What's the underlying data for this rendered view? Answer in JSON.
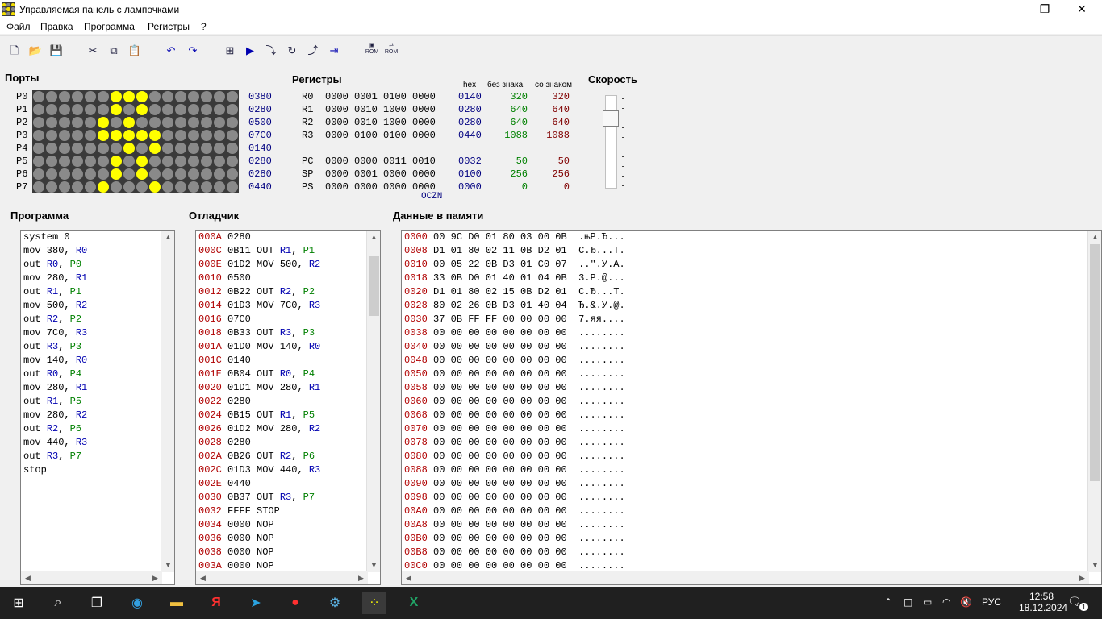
{
  "window": {
    "title": "Управляемая панель с лампочками",
    "minimize": "—",
    "maximize": "❐",
    "close": "✕"
  },
  "menu": [
    "Файл",
    "Правка",
    "Программа",
    "Регистры",
    "?"
  ],
  "toolbar": {
    "rom1": "ROM",
    "rom2": "ROM"
  },
  "ports": {
    "title": "Порты",
    "rows": [
      {
        "label": "P0",
        "hex": "0380"
      },
      {
        "label": "P1",
        "hex": "0280"
      },
      {
        "label": "P2",
        "hex": "0500"
      },
      {
        "label": "P3",
        "hex": "07C0"
      },
      {
        "label": "P4",
        "hex": "0140"
      },
      {
        "label": "P5",
        "hex": "0280"
      },
      {
        "label": "P6",
        "hex": "0280"
      },
      {
        "label": "P7",
        "hex": "0440"
      }
    ],
    "colors": {
      "on": "#ffff00",
      "off": "#8a8a8a",
      "bg": "#3a3a3a"
    }
  },
  "registers": {
    "title": "Регистры",
    "col_hex": "hex",
    "col_unsigned": "без знака",
    "col_signed": "со знаком",
    "rows": [
      {
        "name": "R0",
        "bin": "0000 0001 0100 0000",
        "hex": "0140",
        "u": "320",
        "s": "320"
      },
      {
        "name": "R1",
        "bin": "0000 0010 1000 0000",
        "hex": "0280",
        "u": "640",
        "s": "640"
      },
      {
        "name": "R2",
        "bin": "0000 0010 1000 0000",
        "hex": "0280",
        "u": "640",
        "s": "640"
      },
      {
        "name": "R3",
        "bin": "0000 0100 0100 0000",
        "hex": "0440",
        "u": "1088",
        "s": "1088"
      },
      {
        "name": "PC",
        "bin": "0000 0000 0011 0010",
        "hex": "0032",
        "u": "50",
        "s": "50"
      },
      {
        "name": "SP",
        "bin": "0000 0001 0000 0000",
        "hex": "0100",
        "u": "256",
        "s": "256"
      },
      {
        "name": "PS",
        "bin": "0000 0000 0000 0000",
        "hex": "0000",
        "u": "0",
        "s": "0"
      }
    ],
    "flags_label": "OCZN"
  },
  "speed": {
    "title": "Скорость",
    "level": 0.2
  },
  "program": {
    "title": "Программа",
    "lines": [
      [
        "system",
        " 0",
        ""
      ],
      [
        "mov",
        " 380, ",
        "R0"
      ],
      [
        "out",
        " ",
        "R0, P0"
      ],
      [
        "mov",
        " 280, ",
        "R1"
      ],
      [
        "out",
        " ",
        "R1, P1"
      ],
      [
        "mov",
        " 500, ",
        "R2"
      ],
      [
        "out",
        " ",
        "R2, P2"
      ],
      [
        "mov",
        " 7C0, ",
        "R3"
      ],
      [
        "out",
        " ",
        "R3, P3"
      ],
      [
        "mov",
        " 140, ",
        "R0"
      ],
      [
        "out",
        " ",
        "R0, P4"
      ],
      [
        "mov",
        " 280, ",
        "R1"
      ],
      [
        "out",
        " ",
        "R1, P5"
      ],
      [
        "mov",
        " 280, ",
        "R2"
      ],
      [
        "out",
        " ",
        "R2, P6"
      ],
      [
        "mov",
        " 440, ",
        "R3"
      ],
      [
        "out",
        " ",
        "R3, P7"
      ],
      [
        "stop",
        "",
        ""
      ]
    ]
  },
  "debugger": {
    "title": "Отладчик",
    "lines": [
      [
        "000A",
        "0280",
        ""
      ],
      [
        "000C",
        "0B11",
        "OUT R1, P1"
      ],
      [
        "000E",
        "01D2",
        "MOV 500, R2"
      ],
      [
        "0010",
        "0500",
        ""
      ],
      [
        "0012",
        "0B22",
        "OUT R2, P2"
      ],
      [
        "0014",
        "01D3",
        "MOV 7C0, R3"
      ],
      [
        "0016",
        "07C0",
        ""
      ],
      [
        "0018",
        "0B33",
        "OUT R3, P3"
      ],
      [
        "001A",
        "01D0",
        "MOV 140, R0"
      ],
      [
        "001C",
        "0140",
        ""
      ],
      [
        "001E",
        "0B04",
        "OUT R0, P4"
      ],
      [
        "0020",
        "01D1",
        "MOV 280, R1"
      ],
      [
        "0022",
        "0280",
        ""
      ],
      [
        "0024",
        "0B15",
        "OUT R1, P5"
      ],
      [
        "0026",
        "01D2",
        "MOV 280, R2"
      ],
      [
        "0028",
        "0280",
        ""
      ],
      [
        "002A",
        "0B26",
        "OUT R2, P6"
      ],
      [
        "002C",
        "01D3",
        "MOV 440, R3"
      ],
      [
        "002E",
        "0440",
        ""
      ],
      [
        "0030",
        "0B37",
        "OUT R3, P7"
      ],
      [
        "0032",
        "FFFF",
        "STOP"
      ],
      [
        "0034",
        "0000",
        "NOP"
      ],
      [
        "0036",
        "0000",
        "NOP"
      ],
      [
        "0038",
        "0000",
        "NOP"
      ],
      [
        "003A",
        "0000",
        "NOP"
      ]
    ]
  },
  "memory": {
    "title": "Данные в памяти",
    "lines": [
      [
        "0000",
        "00 9C D0 01 80 03 00 0B",
        ".њР.Ђ..."
      ],
      [
        "0008",
        "D1 01 80 02 11 0B D2 01",
        "С.Ђ...Т."
      ],
      [
        "0010",
        "00 05 22 0B D3 01 C0 07",
        "..\".У.А."
      ],
      [
        "0018",
        "33 0B D0 01 40 01 04 0B",
        "3.Р.@..."
      ],
      [
        "0020",
        "D1 01 80 02 15 0B D2 01",
        "С.Ђ...Т."
      ],
      [
        "0028",
        "80 02 26 0B D3 01 40 04",
        "Ђ.&.У.@."
      ],
      [
        "0030",
        "37 0B FF FF 00 00 00 00",
        "7.яя...."
      ],
      [
        "0038",
        "00 00 00 00 00 00 00 00",
        "........"
      ],
      [
        "0040",
        "00 00 00 00 00 00 00 00",
        "........"
      ],
      [
        "0048",
        "00 00 00 00 00 00 00 00",
        "........"
      ],
      [
        "0050",
        "00 00 00 00 00 00 00 00",
        "........"
      ],
      [
        "0058",
        "00 00 00 00 00 00 00 00",
        "........"
      ],
      [
        "0060",
        "00 00 00 00 00 00 00 00",
        "........"
      ],
      [
        "0068",
        "00 00 00 00 00 00 00 00",
        "........"
      ],
      [
        "0070",
        "00 00 00 00 00 00 00 00",
        "........"
      ],
      [
        "0078",
        "00 00 00 00 00 00 00 00",
        "........"
      ],
      [
        "0080",
        "00 00 00 00 00 00 00 00",
        "........"
      ],
      [
        "0088",
        "00 00 00 00 00 00 00 00",
        "........"
      ],
      [
        "0090",
        "00 00 00 00 00 00 00 00",
        "........"
      ],
      [
        "0098",
        "00 00 00 00 00 00 00 00",
        "........"
      ],
      [
        "00A0",
        "00 00 00 00 00 00 00 00",
        "........"
      ],
      [
        "00A8",
        "00 00 00 00 00 00 00 00",
        "........"
      ],
      [
        "00B0",
        "00 00 00 00 00 00 00 00",
        "........"
      ],
      [
        "00B8",
        "00 00 00 00 00 00 00 00",
        "........"
      ],
      [
        "00C0",
        "00 00 00 00 00 00 00 00",
        "........"
      ]
    ]
  },
  "taskbar": {
    "lang": "РУС",
    "time": "12:58",
    "date": "18.12.2024",
    "notif_count": "1"
  }
}
